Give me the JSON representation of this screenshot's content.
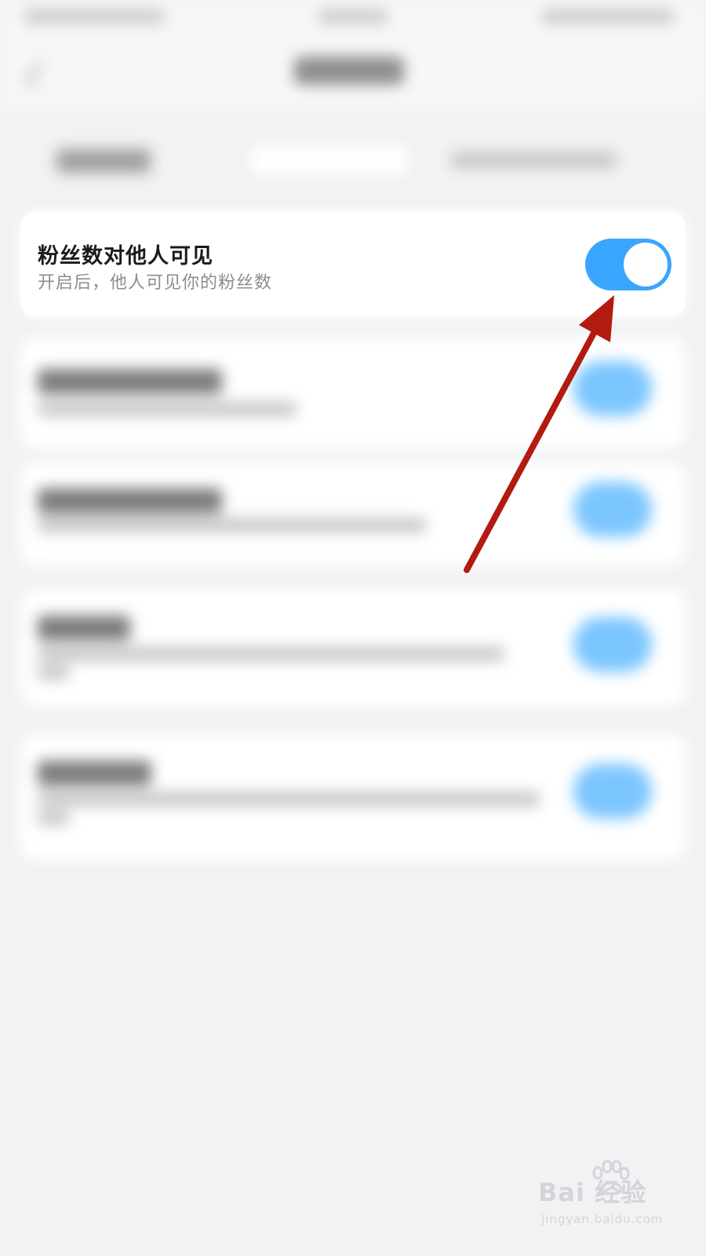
{
  "setting": {
    "title": "粉丝数对他人可见",
    "description": "开启后，他人可见你的粉丝数",
    "enabled": true
  },
  "colors": {
    "toggle_on": "#3aa5ff",
    "background": "#f1f2f4",
    "card": "#ffffff",
    "annotation_arrow": "#b31a10"
  },
  "watermark": {
    "logo": "Bai  经验",
    "url": "jingyan.baidu.com"
  }
}
